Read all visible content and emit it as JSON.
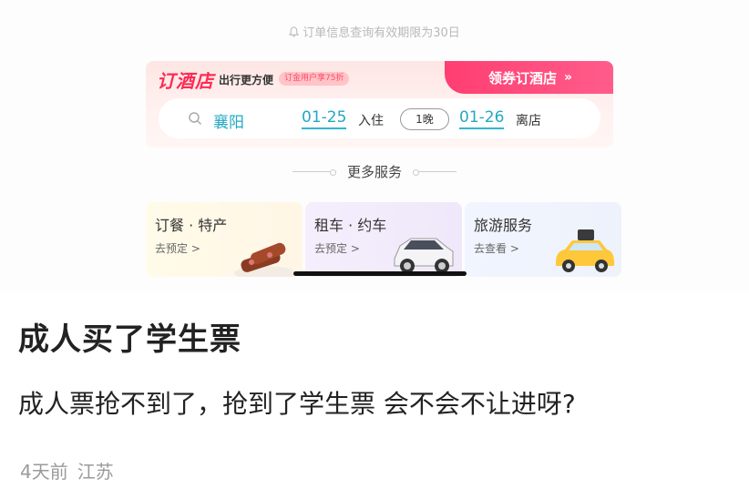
{
  "notice": {
    "text": "订单信息查询有效期限为30日",
    "icon": "bell-icon"
  },
  "hotel": {
    "logo": "订酒店",
    "slogan": "出行更方便",
    "tag": "订金用户享75折",
    "coupon_label": "领券订酒店",
    "coupon_arrow": "»",
    "city": "襄阳",
    "checkin_date": "01-25",
    "checkin_label": "入住",
    "nights": "1晚",
    "checkout_date": "01-26",
    "checkout_label": "离店",
    "accent_color": "#ff3e72",
    "date_color": "#22a8c4"
  },
  "more_services": {
    "label": "更多服务"
  },
  "services": [
    {
      "title": "订餐 · 特产",
      "action": "去预定 >",
      "icon": "food-icon"
    },
    {
      "title": "租车 · 约车",
      "action": "去预定 >",
      "icon": "car-icon"
    },
    {
      "title": "旅游服务",
      "action": "去查看 >",
      "icon": "taxi-icon"
    }
  ],
  "post": {
    "title": "成人买了学生票",
    "body": "成人票抢不到了，抢到了学生票 会不会不让进呀?",
    "time": "4天前",
    "location": "江苏"
  }
}
